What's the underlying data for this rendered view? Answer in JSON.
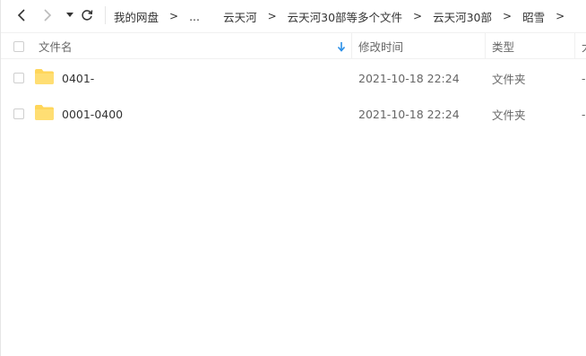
{
  "toolbar": {
    "back_icon": "chevron-left-icon",
    "forward_icon": "chevron-right-icon",
    "dropdown_icon": "caret-down-icon",
    "refresh_icon": "refresh-icon"
  },
  "breadcrumb": {
    "items": [
      "我的网盘",
      "...",
      "云天河",
      "云天河30部等多个文件",
      "云天河30部",
      "昭雪"
    ],
    "separator": ">"
  },
  "columns": {
    "name": "文件名",
    "modified": "修改时间",
    "type": "类型",
    "size": "大"
  },
  "rows": [
    {
      "name": "0401-",
      "modified": "2021-10-18 22:24",
      "type": "文件夹",
      "size": "-"
    },
    {
      "name": "0001-0400",
      "modified": "2021-10-18 22:24",
      "type": "文件夹",
      "size": "-"
    }
  ],
  "colors": {
    "folder": "#FFD65A",
    "sort_arrow": "#2A8FE8"
  }
}
